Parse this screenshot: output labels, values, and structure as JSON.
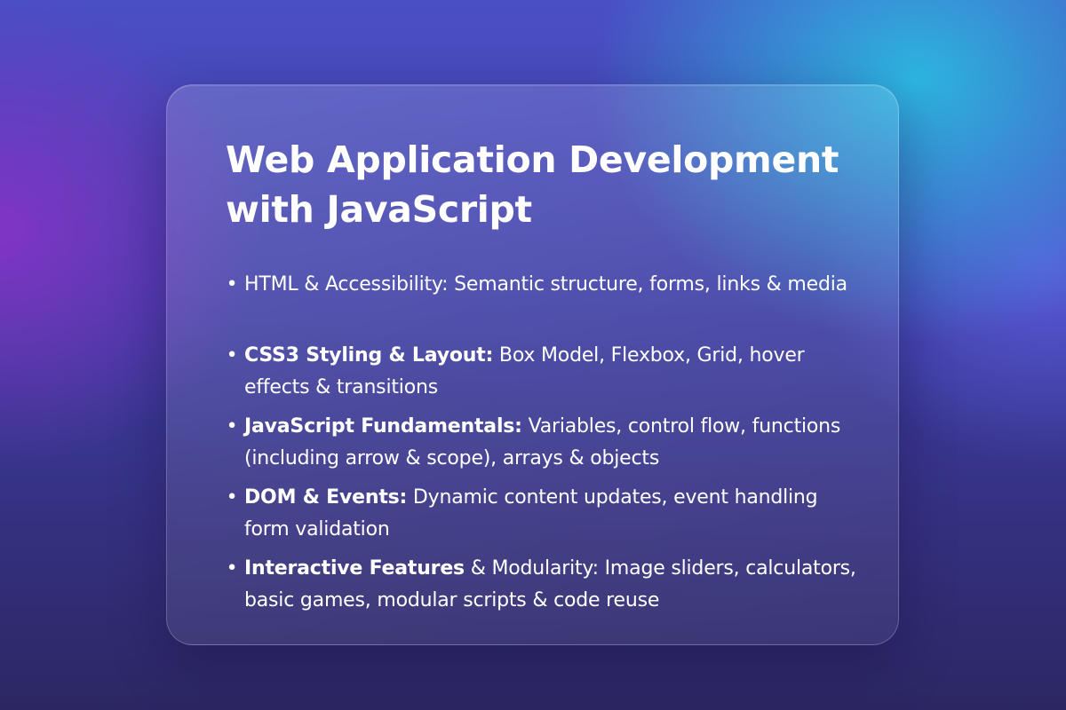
{
  "card": {
    "title": "Web Application Development with JavaScript",
    "bullet_glyph": "•",
    "topics": [
      {
        "bold_lead": "",
        "rest": "HTML & Accessibility: Semantic structure, forms, links & media"
      },
      {
        "bold_lead": "CSS3 Styling & Layout:",
        "rest": " Box Model, Flexbox, Grid, hover effects & transitions"
      },
      {
        "bold_lead": "JavaScript Fundamentals:",
        "rest": " Variables, control flow, functions (including arrow & scope), arrays & objects"
      },
      {
        "bold_lead": "DOM & Events:",
        "rest": " Dynamic content updates, event handling form validation"
      },
      {
        "bold_lead": "Interactive Features",
        "rest": " & Modularity: Image sliders, calculators, basic games, modular scripts & code reuse"
      }
    ]
  },
  "colors": {
    "text": "#ffffff",
    "background_top": "#4a4fc4",
    "background_bottom": "#2c2763",
    "accent_cyan": "#28c8e6",
    "accent_purple": "#8c32c8"
  }
}
